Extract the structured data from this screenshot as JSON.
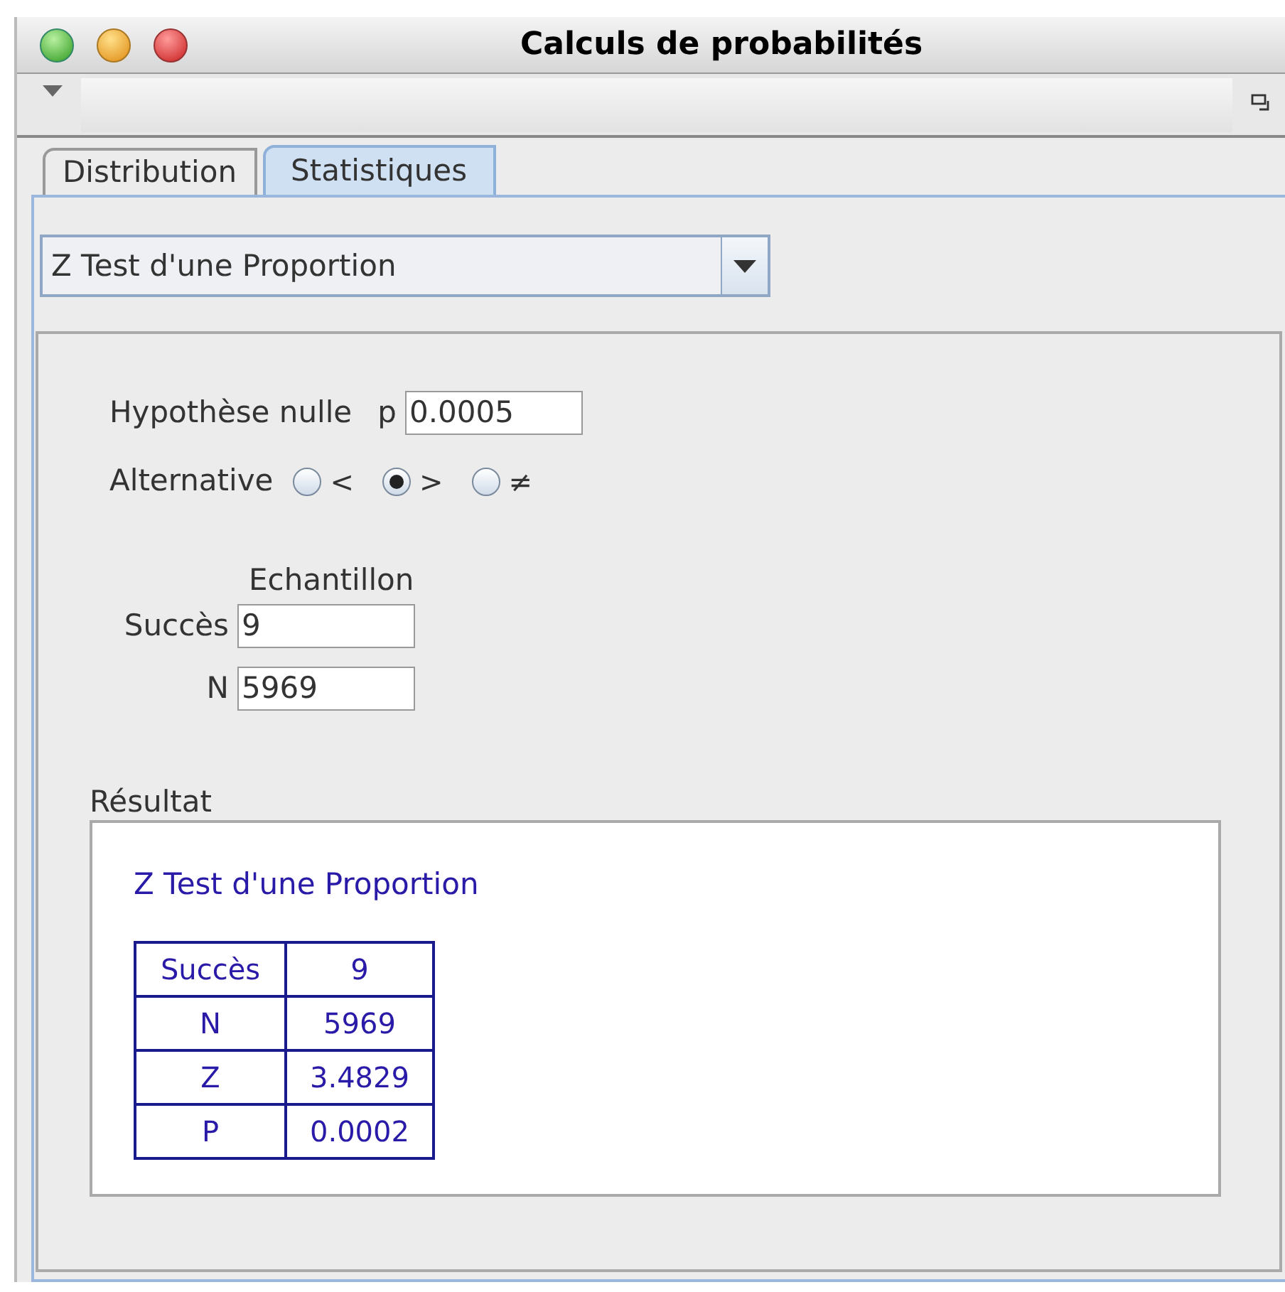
{
  "window": {
    "title": "Calculs de probabilités"
  },
  "tabs": [
    {
      "label": "Distribution",
      "selected": false
    },
    {
      "label": "Statistiques",
      "selected": true
    }
  ],
  "test_select": {
    "value": "Z Test d'une Proportion"
  },
  "null_hypothesis": {
    "label": "Hypothèse nulle",
    "parameter": "p",
    "value": "0.0005"
  },
  "alternative": {
    "label": "Alternative",
    "options": [
      {
        "symbol": "<",
        "selected": false
      },
      {
        "symbol": ">",
        "selected": true
      },
      {
        "symbol": "≠",
        "selected": false
      }
    ]
  },
  "sample": {
    "heading": "Echantillon",
    "fields": [
      {
        "label": "Succès",
        "value": "9"
      },
      {
        "label": "N",
        "value": "5969"
      }
    ]
  },
  "result": {
    "label": "Résultat",
    "title": "Z Test d'une Proportion",
    "rows": [
      {
        "name": "Succès",
        "value": "9"
      },
      {
        "name": "N",
        "value": "5969"
      },
      {
        "name": "Z",
        "value": "3.4829"
      },
      {
        "name": "P",
        "value": "0.0002"
      }
    ]
  }
}
